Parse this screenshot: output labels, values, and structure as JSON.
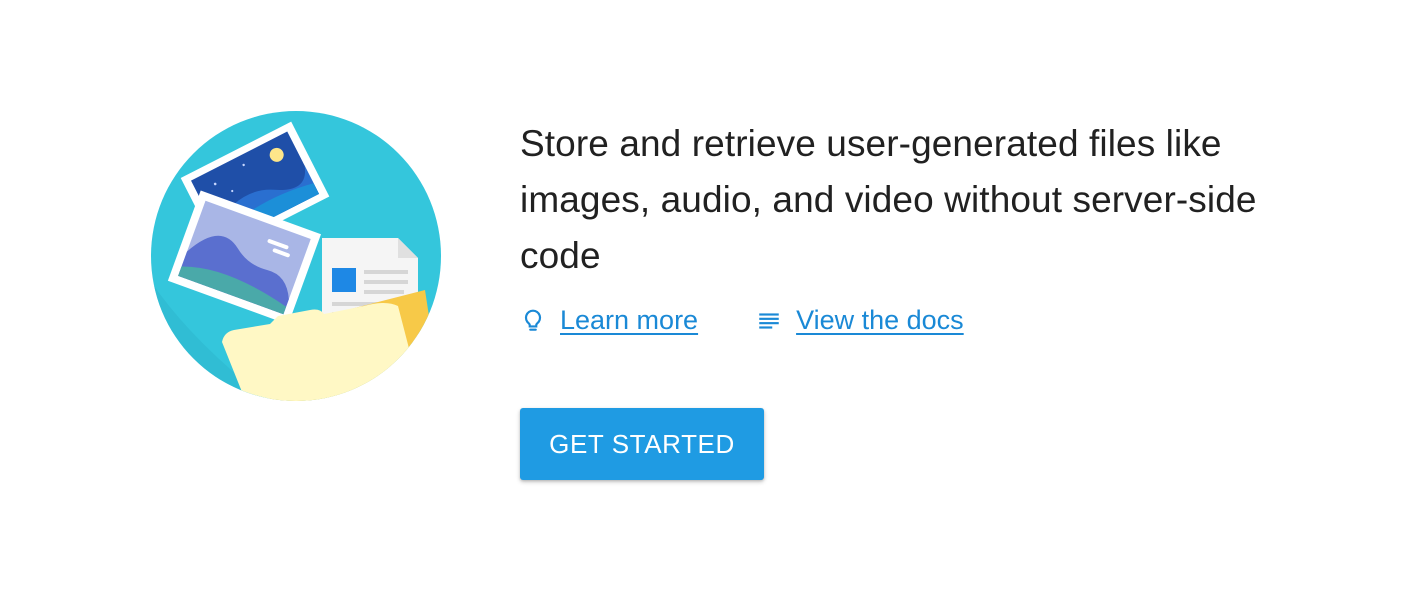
{
  "hero": {
    "headline": "Store and retrieve user-generated files like images, audio, and video without server-side code",
    "illustration_icon": "cloud-storage-illustration"
  },
  "links": [
    {
      "label": "Learn more",
      "icon": "lightbulb-icon"
    },
    {
      "label": "View the docs",
      "icon": "docs-lines-icon"
    }
  ],
  "cta": {
    "label": "GET STARTED"
  },
  "colors": {
    "accent": "#1f9be3",
    "link": "#1a89d6",
    "text": "#212121",
    "circle": "#34c6dc"
  }
}
